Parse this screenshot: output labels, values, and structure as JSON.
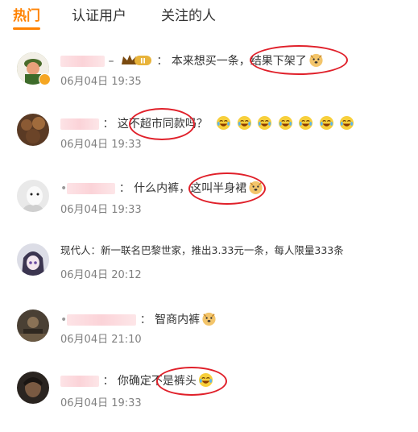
{
  "tabs": [
    {
      "label": "热门",
      "active": true
    },
    {
      "label": "认证用户",
      "active": false
    },
    {
      "label": "关注的人",
      "active": false
    }
  ],
  "colors": {
    "accent": "#ff8200",
    "highlight_circle": "#e0202a",
    "time": "#808080"
  },
  "comments": [
    {
      "name": "",
      "text": "本来想买一条，",
      "highlight": "结果下架了",
      "emoji": "doge-icon",
      "time": "06月04日 19:35",
      "verified": true,
      "level_badge": "Ⅱ"
    },
    {
      "name": "",
      "text_before": "这不",
      "highlight": "超市同款吗？",
      "emoji_count": 7,
      "emoji": "laugh-cry-icon",
      "time": "06月04日 19:33"
    },
    {
      "name": "",
      "text": "什么内裤，",
      "highlight": "这叫半身裙",
      "emoji": "doge-icon",
      "time": "06月04日 19:33"
    },
    {
      "name": "现代人",
      "text": "新一联名巴黎世家，推出3.33元一条，每人限量333条",
      "time": "06月04日 20:12"
    },
    {
      "name": "",
      "text": "智商内裤",
      "emoji": "doge-icon",
      "time": "06月04日 21:10"
    },
    {
      "name": "",
      "text_before": "你确定不",
      "highlight": "是裤头",
      "emoji": "laugh-cry-icon",
      "time": "06月04日 19:33"
    }
  ]
}
